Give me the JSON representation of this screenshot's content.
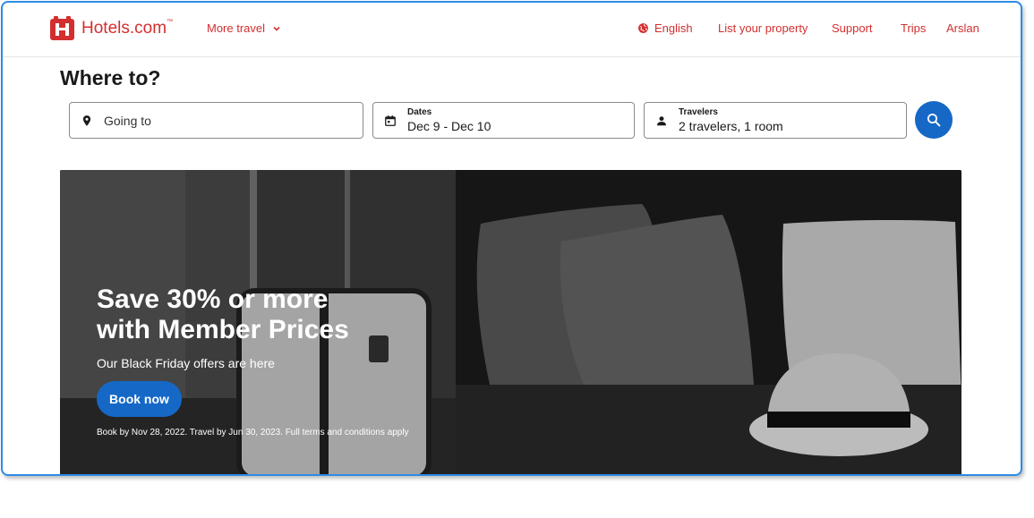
{
  "header": {
    "brand": "Hotels.com",
    "brand_tm": "™",
    "more_travel": "More travel",
    "language": "English",
    "list_property": "List your property",
    "support": "Support",
    "trips": "Trips",
    "user": "Arslan"
  },
  "search": {
    "title": "Where to?",
    "destination_placeholder": "Going to",
    "dates_label": "Dates",
    "dates_value": "Dec 9 - Dec 10",
    "travelers_label": "Travelers",
    "travelers_value": "2 travelers, 1 room"
  },
  "hero": {
    "title_line1": "Save 30% or more",
    "title_line2": "with Member Prices",
    "subtitle": "Our Black Friday offers are here",
    "cta": "Book now",
    "terms": "Book by Nov 28, 2022. Travel by Jun 30, 2023. Full terms and conditions apply"
  },
  "colors": {
    "brand_red": "#d32f2f",
    "primary_blue": "#1668c7",
    "frame_blue": "#2e8be6"
  },
  "icons": [
    "hotels-logo-icon",
    "chevron-down-icon",
    "globe-icon",
    "location-pin-icon",
    "calendar-icon",
    "person-icon",
    "search-icon"
  ]
}
